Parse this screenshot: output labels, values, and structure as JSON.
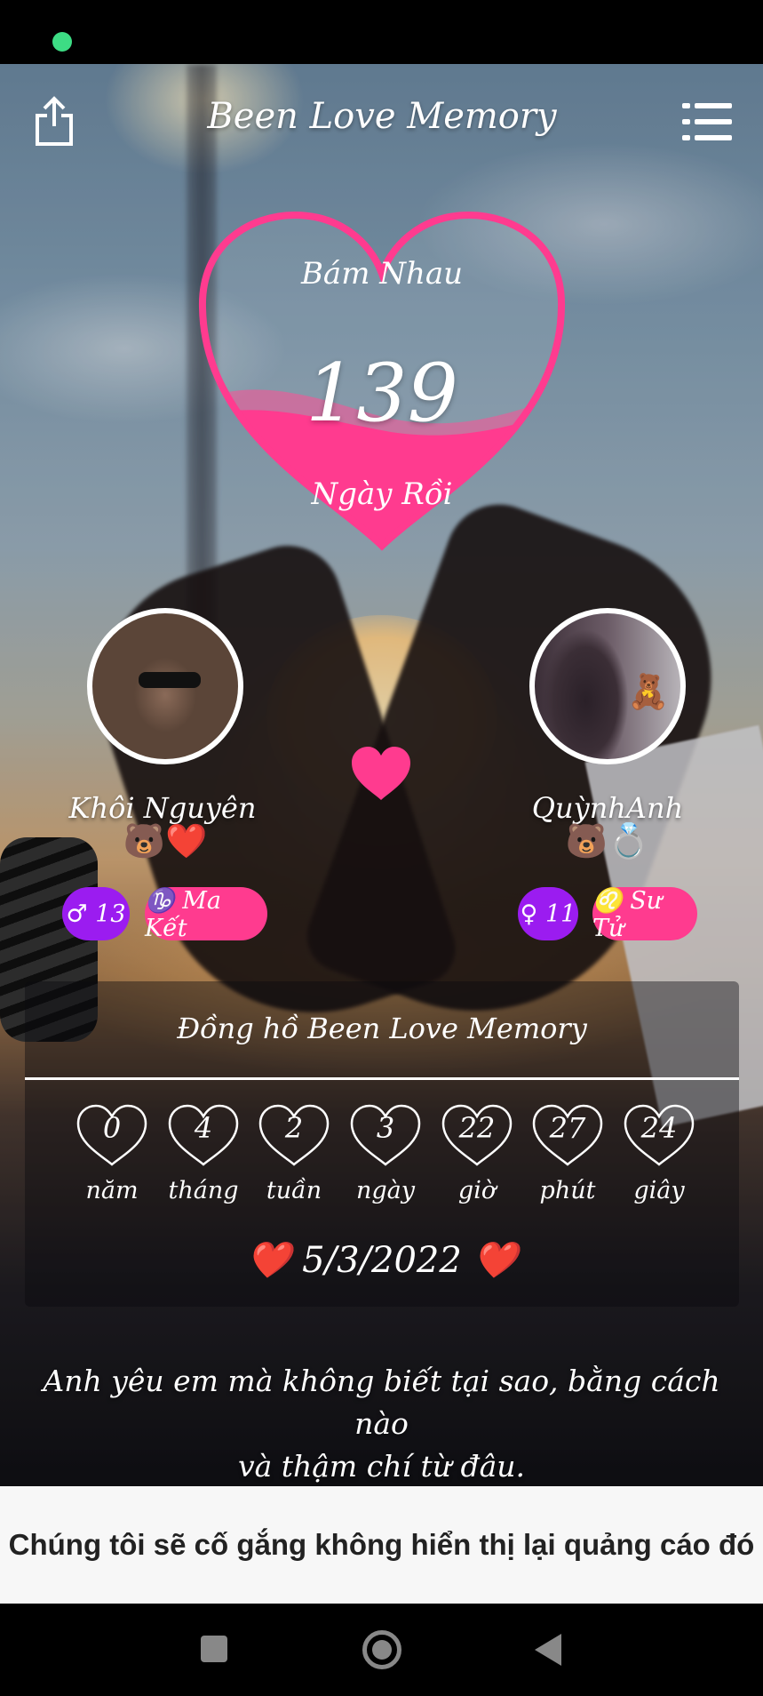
{
  "app": {
    "title": "Been Love Memory"
  },
  "counter": {
    "top_label": "Bám Nhau",
    "days": "139",
    "bottom_label": "Ngày Rồi"
  },
  "partners": {
    "left": {
      "name": "Khôi Nguyên",
      "emojis": "🐻❤️",
      "age_badge": "♂ 13",
      "zodiac_badge": "♑ Ma Kết"
    },
    "right": {
      "name": "QuỳnhAnh",
      "emojis": "🐻💍",
      "avatar_sticker": "🧸",
      "age_badge": "♀ 11",
      "zodiac_badge": "♌ Sư Tử"
    }
  },
  "clock": {
    "title": "Đồng hồ Been Love Memory",
    "units": [
      {
        "value": "0",
        "label": "năm"
      },
      {
        "value": "4",
        "label": "tháng"
      },
      {
        "value": "2",
        "label": "tuần"
      },
      {
        "value": "3",
        "label": "ngày"
      },
      {
        "value": "22",
        "label": "giờ"
      },
      {
        "value": "27",
        "label": "phút"
      },
      {
        "value": "24",
        "label": "giây"
      }
    ],
    "start_date": "5/3/2022",
    "heart_glyph": "❤️"
  },
  "quote": {
    "line1": "Anh yêu em mà không biết tại sao, bằng cách nào",
    "line2": "và thậm chí từ đâu."
  },
  "ad": {
    "message": "Chúng tôi sẽ cố gắng không hiển thị lại quảng cáo đó"
  },
  "colors": {
    "accent_pink": "#ff3b8f",
    "badge_purple": "#9b1cf0",
    "status_green": "#3ddc84",
    "date_heart_red": "#ef2b3a"
  },
  "icons": {
    "share": "share-icon",
    "menu": "menu-icon",
    "heart": "heart-icon",
    "nav_recent": "square-icon",
    "nav_home": "circle-icon",
    "nav_back": "triangle-back-icon"
  }
}
